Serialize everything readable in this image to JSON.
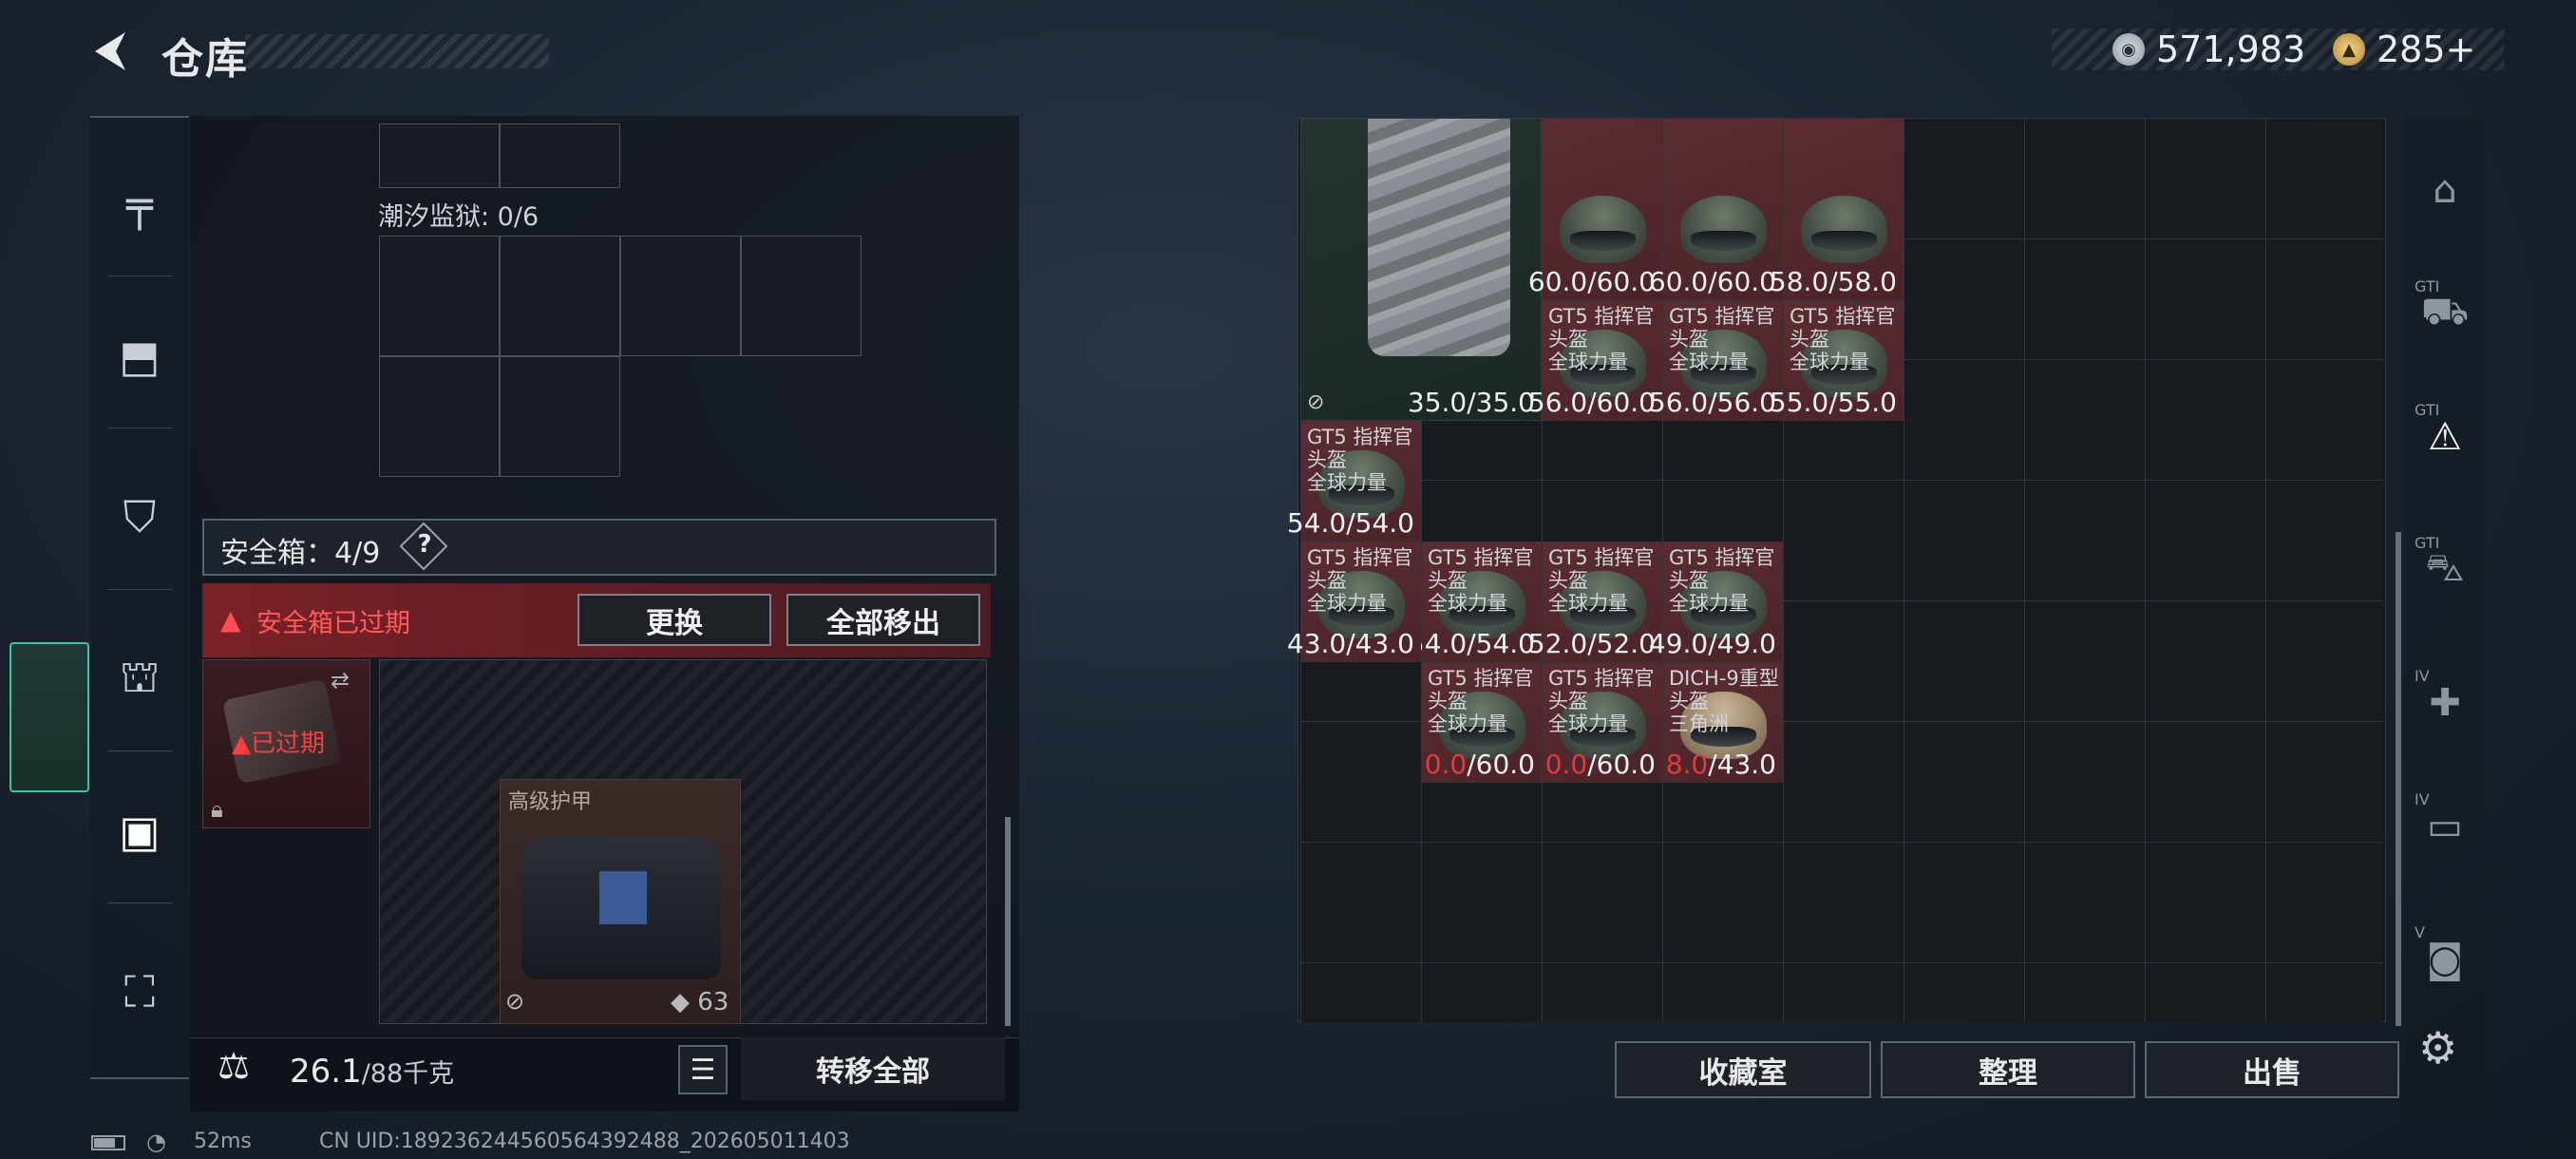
{
  "header": {
    "title": "仓库",
    "back_icon": "back-arrow-icon"
  },
  "currency": {
    "silver": "571,983",
    "gold": "285",
    "plus": "+"
  },
  "left_nav": [
    {
      "name": "weapon",
      "icon": "pistol-icon",
      "glyph": "╤"
    },
    {
      "name": "vest",
      "icon": "vest-icon",
      "glyph": "⬒"
    },
    {
      "name": "rig",
      "icon": "backpack-a-icon",
      "glyph": "⛉"
    },
    {
      "name": "backpack",
      "icon": "backpack-icon",
      "glyph": "⛫"
    },
    {
      "name": "safebox",
      "icon": "safebox-icon",
      "glyph": "▣",
      "active": true
    },
    {
      "name": "toolbox",
      "icon": "toolbox-icon",
      "glyph": "⛶"
    }
  ],
  "left_panel": {
    "tidal_label": "潮汐监狱: 0/6",
    "safe_label": "安全箱：4/9",
    "help": "?",
    "expired_text": "安全箱已过期",
    "replace_btn": "更换",
    "remove_all_btn": "全部移出",
    "safebox_expired": "已过期",
    "armor_label": "高级护甲",
    "armor_durability": "63",
    "weight_value": "26.1",
    "weight_unit": "/88千克",
    "transfer_btn": "转移全部"
  },
  "status": {
    "ping": "52ms",
    "uid": "CN UID:189236244560564392488_202605011403"
  },
  "inventory": [
    {
      "name": "",
      "sub": "",
      "cur": "35.0",
      "max": "35.0",
      "type": "vest"
    },
    {
      "name": "",
      "sub": "",
      "cur": "60.0",
      "max": "60.0"
    },
    {
      "name": "",
      "sub": "",
      "cur": "60.0",
      "max": "60.0"
    },
    {
      "name": "",
      "sub": "",
      "cur": "58.0",
      "max": "58.0"
    },
    {
      "name": "GT5 指挥官头盔",
      "sub": "全球力量",
      "cur": "56.0",
      "max": "60.0"
    },
    {
      "name": "GT5 指挥官头盔",
      "sub": "全球力量",
      "cur": "56.0",
      "max": "56.0"
    },
    {
      "name": "GT5 指挥官头盔",
      "sub": "全球力量",
      "cur": "55.0",
      "max": "55.0"
    },
    {
      "name": "GT5 指挥官头盔",
      "sub": "全球力量",
      "cur": "54.0",
      "max": "54.0"
    },
    {
      "name": "GT5 指挥官头盔",
      "sub": "全球力量",
      "cur": "54.0",
      "max": "54.0"
    },
    {
      "name": "GT5 指挥官头盔",
      "sub": "全球力量",
      "cur": "52.0",
      "max": "52.0"
    },
    {
      "name": "GT5 指挥官头盔",
      "sub": "全球力量",
      "cur": "49.0",
      "max": "49.0"
    },
    {
      "name": "GT5 指挥官头盔",
      "sub": "全球力量",
      "cur": "43.0",
      "max": "43.0"
    },
    {
      "name": "GT5 指挥官头盔",
      "sub": "全球力量",
      "cur": "0.0",
      "max": "60.0",
      "low": true
    },
    {
      "name": "GT5 指挥官头盔",
      "sub": "全球力量",
      "cur": "0.0",
      "max": "60.0",
      "low": true
    },
    {
      "name": "DICH-9重型头盔",
      "sub": "三角洲",
      "cur": "8.0",
      "max": "43.0",
      "low": true,
      "type": "dich"
    }
  ],
  "bottom_buttons": {
    "collection": "收藏室",
    "arrange": "整理",
    "sell": "出售"
  },
  "right_tabs": [
    {
      "icon": "storage-arch-icon",
      "label": ""
    },
    {
      "icon": "gti-truck-icon",
      "label": "GTI"
    },
    {
      "icon": "gti-warning-icon",
      "label": "GTI"
    },
    {
      "icon": "gti-bus-icon",
      "label": "GTI"
    },
    {
      "icon": "iv-medkit-icon",
      "label": "IV"
    },
    {
      "icon": "iv-folder-icon",
      "label": "IV"
    },
    {
      "icon": "v-camera-icon",
      "label": "V"
    }
  ],
  "colors": {
    "accent": "#3ac4a0",
    "expired": "#e23a3a",
    "item_bg": "#5b2d33"
  }
}
